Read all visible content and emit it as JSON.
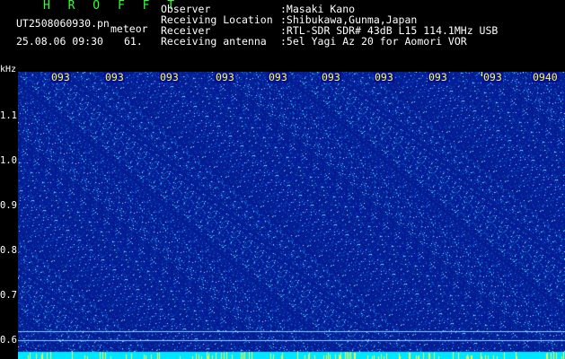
{
  "header": {
    "brand": "H R O F F T",
    "filename": "UT2508060930.pn",
    "meteor_tag": "meteor",
    "datetime": "25.08.06 09:30",
    "detect_value": "61.",
    "info": [
      {
        "label": "Observer",
        "value": ":Masaki Kano"
      },
      {
        "label": "Receiving Location",
        "value": ":Shibukawa,Gunma,Japan"
      },
      {
        "label": "Receiver",
        "value": ":RTL-SDR SDR# 43dB L15 114.1MHz USB"
      },
      {
        "label": "Receiving antenna",
        "value": ":5el Yagi Az 20 for Aomori VOR"
      }
    ]
  },
  "axis": {
    "unit": "kHz",
    "y_ticks": [
      "1.1",
      "1.0",
      "0.9",
      "0.8",
      "0.7",
      "0.6"
    ],
    "x_ticks": [
      "093",
      "093",
      "093",
      "093",
      "093",
      "093",
      "093",
      "093",
      "093",
      "0940"
    ]
  },
  "colors": {
    "background": "#000000",
    "spectrogram_base": "#061a9c",
    "time_label": "#ffff33",
    "brand": "#33ff33",
    "bottom_band": "#00e6ff"
  }
}
